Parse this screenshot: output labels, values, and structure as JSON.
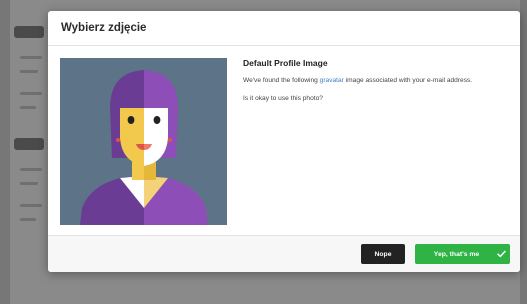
{
  "modal": {
    "title": "Wybierz zdjęcie",
    "image_alt": "Default Profile Image",
    "content_title": "Default Profile Image",
    "text_before_link": "We've found the following ",
    "link_text": "gravatar",
    "text_after_link": " image associated with your e-mail address.",
    "question": "Is it okay to use this photo?",
    "buttons": {
      "nope": "Nope",
      "yes": "Yep, that's me"
    },
    "icons": {
      "confirm": "check-icon"
    },
    "colors": {
      "link": "#3b7fc4",
      "nope_bg": "#222222",
      "yes_bg": "#2fb344",
      "avatar_bg": "#5c7388"
    }
  }
}
